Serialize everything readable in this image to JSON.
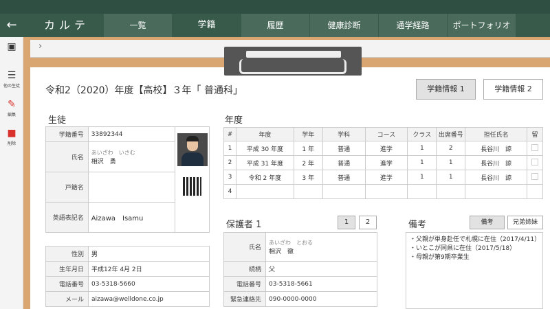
{
  "app_title": "カルテ",
  "tabs": [
    "一覧",
    "学籍",
    "履歴",
    "健康診断",
    "通学経路",
    "ポートフォリオ"
  ],
  "sidebar": [
    {
      "icon": "person-card-icon",
      "label": ""
    },
    {
      "icon": "list-icon",
      "label": "他の生徒"
    },
    {
      "icon": "pencil-icon",
      "label": "編集"
    },
    {
      "icon": "trash-icon",
      "label": "削除"
    }
  ],
  "page_title": "令和2（2020）年度【高校】３年「 普通科」",
  "info_buttons": [
    "学籍情報 1",
    "学籍情報 2"
  ],
  "student": {
    "heading": "生徒",
    "id_label": "学籍番号",
    "id": "33892344",
    "name_label": "氏名",
    "name_kana": "あいざわ　いさむ",
    "name": "相沢　勇",
    "family_label": "戸籍名",
    "family": "",
    "english_label": "英語表記名",
    "english": "Aizawa　Isamu",
    "gender_label": "性別",
    "gender": "男",
    "birth_label": "生年月日",
    "birth": "平成12年 4月 2日",
    "phone_label": "電話番号",
    "phone": "03-5318-5660",
    "mail_label": "メール",
    "mail": "aizawa@welldone.co.jp"
  },
  "years": {
    "heading": "年度",
    "headers": [
      "#",
      "年度",
      "学年",
      "学科",
      "コース",
      "クラス",
      "出席番号",
      "担任氏名",
      "留"
    ],
    "rows": [
      [
        "1",
        "平成 30 年度",
        "1 年",
        "普通",
        "進学",
        "1",
        "2",
        "長谷川　諒"
      ],
      [
        "2",
        "平成 31 年度",
        "2 年",
        "普通",
        "進学",
        "1",
        "1",
        "長谷川　諒"
      ],
      [
        "3",
        "令和 2 年度",
        "3 年",
        "普通",
        "進学",
        "1",
        "1",
        "長谷川　諒"
      ],
      [
        "4",
        "",
        "",
        "",
        "",
        "",
        "",
        ""
      ]
    ]
  },
  "guardian": {
    "heading": "保護者 1",
    "pages": [
      "1",
      "2"
    ],
    "name_label": "氏名",
    "name_kana": "あいざわ　とおる",
    "name": "相沢　徹",
    "relation_label": "続柄",
    "relation": "父",
    "phone_label": "電話番号",
    "phone": "03-5318-5661",
    "emergency_label": "緊急連絡先",
    "emergency": "090-0000-0000"
  },
  "notes": {
    "heading": "備考",
    "buttons": [
      "備考",
      "兄弟姉妹"
    ],
    "lines": [
      "・父親が単身赴任で札幌に在住（2017/4/11）",
      "・いとこが同県に在住（2017/5/18）",
      "・母親が第9期卒業生"
    ]
  }
}
